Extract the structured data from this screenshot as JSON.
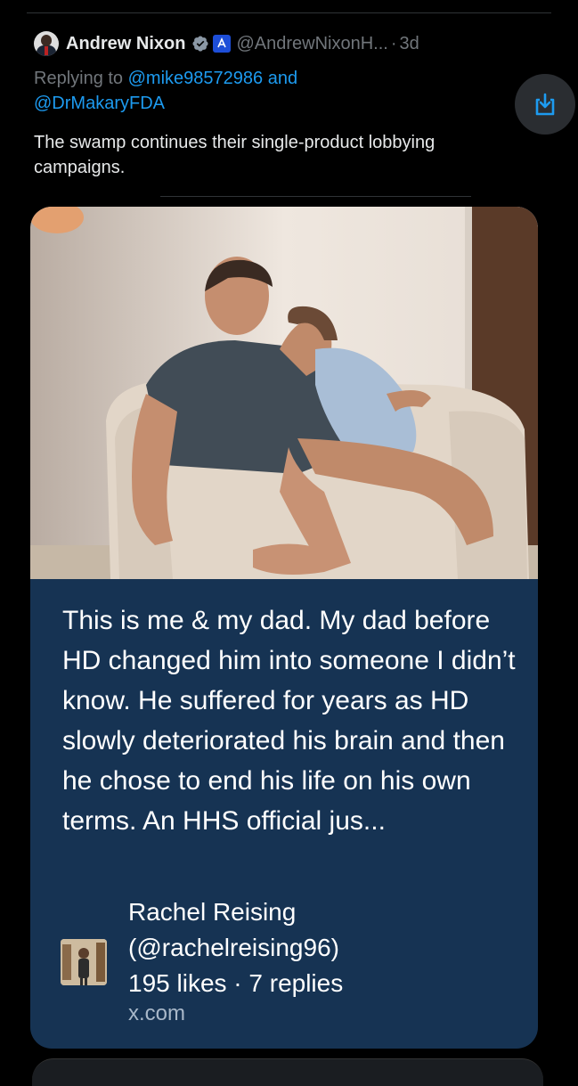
{
  "tweet": {
    "author_name": "Andrew Nixon",
    "handle": "@AndrewNixonH...",
    "separator": "·",
    "time": "3d",
    "replying_prefix": "Replying to",
    "reply_mention_1": "@mike98572986",
    "reply_and": "and",
    "reply_mention_2": "@DrMakaryFDA",
    "text": "The swamp continues their single-product lobbying campaigns."
  },
  "card": {
    "text": "This is me & my dad. My dad before HD changed him into someone I didn’t know. He suffered for years as HD slowly deteriorated his brain and then he chose to end his life on his own terms. An HHS official jus...",
    "author_name": "Rachel Reising",
    "author_handle": "(@rachelreising96)",
    "stats": "195 likes · 7 replies",
    "domain": "x.com"
  },
  "icons": {
    "verified": "verified-check-icon",
    "government": "government-badge-icon",
    "save": "download-save-icon"
  },
  "colors": {
    "background": "#000000",
    "link": "#1d9bf0",
    "muted": "#71767b",
    "card_background": "#163353"
  }
}
